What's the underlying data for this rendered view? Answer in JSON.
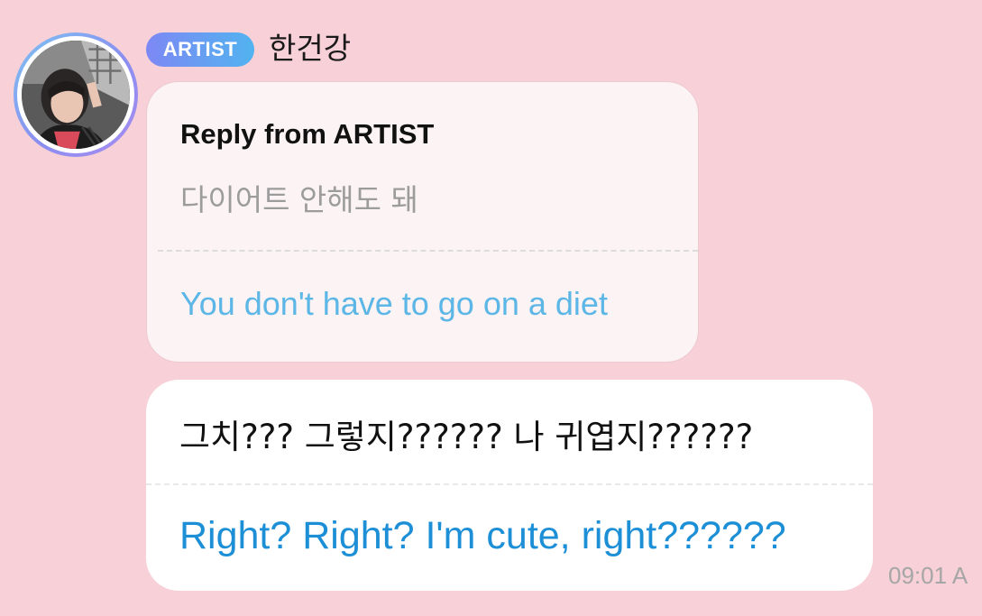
{
  "sender": {
    "badge": "ARTIST",
    "name": "한건강",
    "avatar_icon": "profile-photo"
  },
  "reply": {
    "heading": "Reply from ARTIST",
    "original": "다이어트 안해도 돼",
    "translation": "You don't have to go on a diet"
  },
  "message": {
    "original": "그치??? 그렇지?????? 나 귀엽지??????",
    "translation": "Right? Right? I'm cute, right??????",
    "timestamp": "09:01 A"
  },
  "colors": {
    "background": "#f7d0d8",
    "badge_gradient_start": "#7d88f4",
    "badge_gradient_end": "#52b3f0",
    "translation_light": "#5cb6e6",
    "translation_dark": "#1d8fd6"
  }
}
